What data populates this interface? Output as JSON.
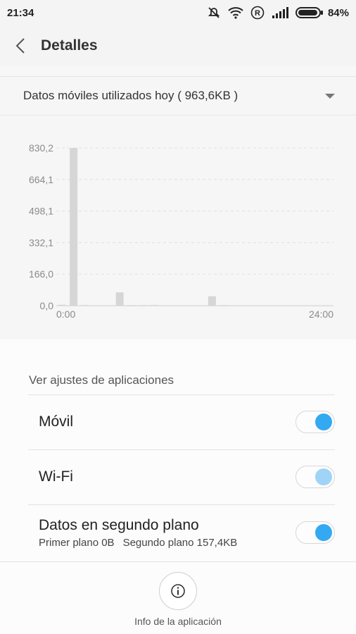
{
  "status_bar": {
    "time": "21:34",
    "battery_percent": "84%"
  },
  "header": {
    "title": "Detalles"
  },
  "usage_dropdown": {
    "label": "Datos móviles utilizados hoy ( 963,6KB )"
  },
  "chart_data": {
    "type": "bar",
    "ytick_labels": [
      "830,2",
      "664,1",
      "498,1",
      "332,1",
      "166,0",
      "0,0"
    ],
    "xtick_labels": [
      "0:00",
      "24:00"
    ],
    "ylim": [
      0,
      830.2
    ],
    "x": [
      0,
      1,
      2,
      3,
      4,
      5,
      6,
      7,
      8,
      9,
      10,
      11,
      12,
      13,
      14,
      15,
      16,
      17,
      18,
      19,
      20,
      21,
      22,
      23
    ],
    "values": [
      5,
      830,
      4,
      0,
      0,
      70,
      3,
      3,
      4,
      0,
      0,
      0,
      0,
      50,
      3,
      0,
      0,
      0,
      0,
      0,
      0,
      0,
      0,
      0
    ],
    "grid": true
  },
  "settings": {
    "section_title": "Ver ajustes de aplicaciones",
    "mobile": {
      "label": "Móvil",
      "enabled": true
    },
    "wifi": {
      "label": "Wi-Fi",
      "enabled": true
    },
    "background": {
      "label": "Datos en segundo plano",
      "foreground_text": "Primer plano 0B",
      "background_text": "Segundo plano 157,4KB",
      "enabled": true
    }
  },
  "footer": {
    "info_label": "Info de la aplicación"
  }
}
